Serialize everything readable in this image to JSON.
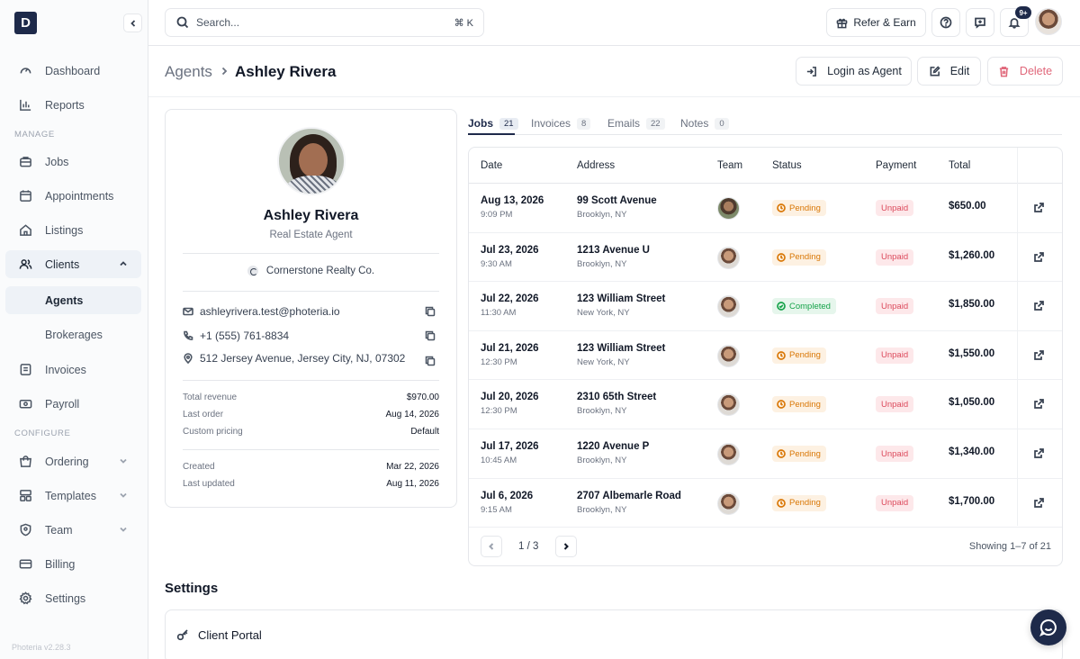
{
  "app": {
    "logo_letter": "D",
    "version": "Photeria v2.28.3"
  },
  "sidebar": {
    "items": [
      {
        "label": "Dashboard",
        "icon": "gauge-icon"
      },
      {
        "label": "Reports",
        "icon": "bar-chart-icon"
      }
    ],
    "manage_label": "MANAGE",
    "manage_items": [
      {
        "label": "Jobs",
        "icon": "briefcase-icon"
      },
      {
        "label": "Appointments",
        "icon": "calendar-icon"
      },
      {
        "label": "Listings",
        "icon": "home-icon"
      },
      {
        "label": "Clients",
        "icon": "users-icon"
      }
    ],
    "client_sub": [
      {
        "label": "Agents"
      },
      {
        "label": "Brokerages"
      }
    ],
    "more_items": [
      {
        "label": "Invoices",
        "icon": "invoice-icon"
      },
      {
        "label": "Payroll",
        "icon": "payroll-icon"
      }
    ],
    "configure_label": "CONFIGURE",
    "configure_items": [
      {
        "label": "Ordering",
        "icon": "cart-icon"
      },
      {
        "label": "Templates",
        "icon": "templates-icon"
      },
      {
        "label": "Team",
        "icon": "shield-icon"
      },
      {
        "label": "Billing",
        "icon": "card-icon"
      },
      {
        "label": "Settings",
        "icon": "gear-icon"
      }
    ]
  },
  "topbar": {
    "search_placeholder": "Search...",
    "search_shortcut": "⌘ K",
    "refer_label": "Refer & Earn",
    "notif_count": "9+"
  },
  "header": {
    "breadcrumb_root": "Agents",
    "breadcrumb_current": "Ashley Rivera",
    "login_label": "Login as Agent",
    "edit_label": "Edit",
    "delete_label": "Delete"
  },
  "profile": {
    "name": "Ashley Rivera",
    "role": "Real Estate Agent",
    "company": "Cornerstone Realty Co.",
    "email": "ashleyrivera.test@photeria.io",
    "phone": "+1 (555) 761-8834",
    "address": "512 Jersey Avenue, Jersey City, NJ, 07302",
    "stats": [
      {
        "label": "Total revenue",
        "value": "$970.00"
      },
      {
        "label": "Last order",
        "value": "Aug 14, 2026"
      },
      {
        "label": "Custom pricing",
        "value": "Default"
      }
    ],
    "meta": [
      {
        "label": "Created",
        "value": "Mar 22, 2026"
      },
      {
        "label": "Last updated",
        "value": "Aug 11, 2026"
      }
    ]
  },
  "tabs": [
    {
      "label": "Jobs",
      "count": "21"
    },
    {
      "label": "Invoices",
      "count": "8"
    },
    {
      "label": "Emails",
      "count": "22"
    },
    {
      "label": "Notes",
      "count": "0"
    }
  ],
  "jobs": {
    "columns": [
      "Date",
      "Address",
      "Team",
      "Status",
      "Payment",
      "Total"
    ],
    "rows": [
      {
        "date": "Aug 13, 2026",
        "time": "9:09 PM",
        "address": "99 Scott Avenue",
        "city": "Brooklyn, NY",
        "status": "Pending",
        "payment": "Unpaid",
        "total": "$650.00"
      },
      {
        "date": "Jul 23, 2026",
        "time": "9:30 AM",
        "address": "1213 Avenue U",
        "city": "Brooklyn, NY",
        "status": "Pending",
        "payment": "Unpaid",
        "total": "$1,260.00"
      },
      {
        "date": "Jul 22, 2026",
        "time": "11:30 AM",
        "address": "123 William Street",
        "city": "New York, NY",
        "status": "Completed",
        "payment": "Unpaid",
        "total": "$1,850.00"
      },
      {
        "date": "Jul 21, 2026",
        "time": "12:30 PM",
        "address": "123 William Street",
        "city": "New York, NY",
        "status": "Pending",
        "payment": "Unpaid",
        "total": "$1,550.00"
      },
      {
        "date": "Jul 20, 2026",
        "time": "12:30 PM",
        "address": "2310 65th Street",
        "city": "Brooklyn, NY",
        "status": "Pending",
        "payment": "Unpaid",
        "total": "$1,050.00"
      },
      {
        "date": "Jul 17, 2026",
        "time": "10:45 AM",
        "address": "1220 Avenue P",
        "city": "Brooklyn, NY",
        "status": "Pending",
        "payment": "Unpaid",
        "total": "$1,340.00"
      },
      {
        "date": "Jul 6, 2026",
        "time": "9:15 AM",
        "address": "2707 Albemarle Road",
        "city": "Brooklyn, NY",
        "status": "Pending",
        "payment": "Unpaid",
        "total": "$1,700.00"
      }
    ],
    "pager": "1 / 3",
    "showing": "Showing 1–7 of 21"
  },
  "settings": {
    "title": "Settings",
    "portal_title": "Client Portal"
  }
}
